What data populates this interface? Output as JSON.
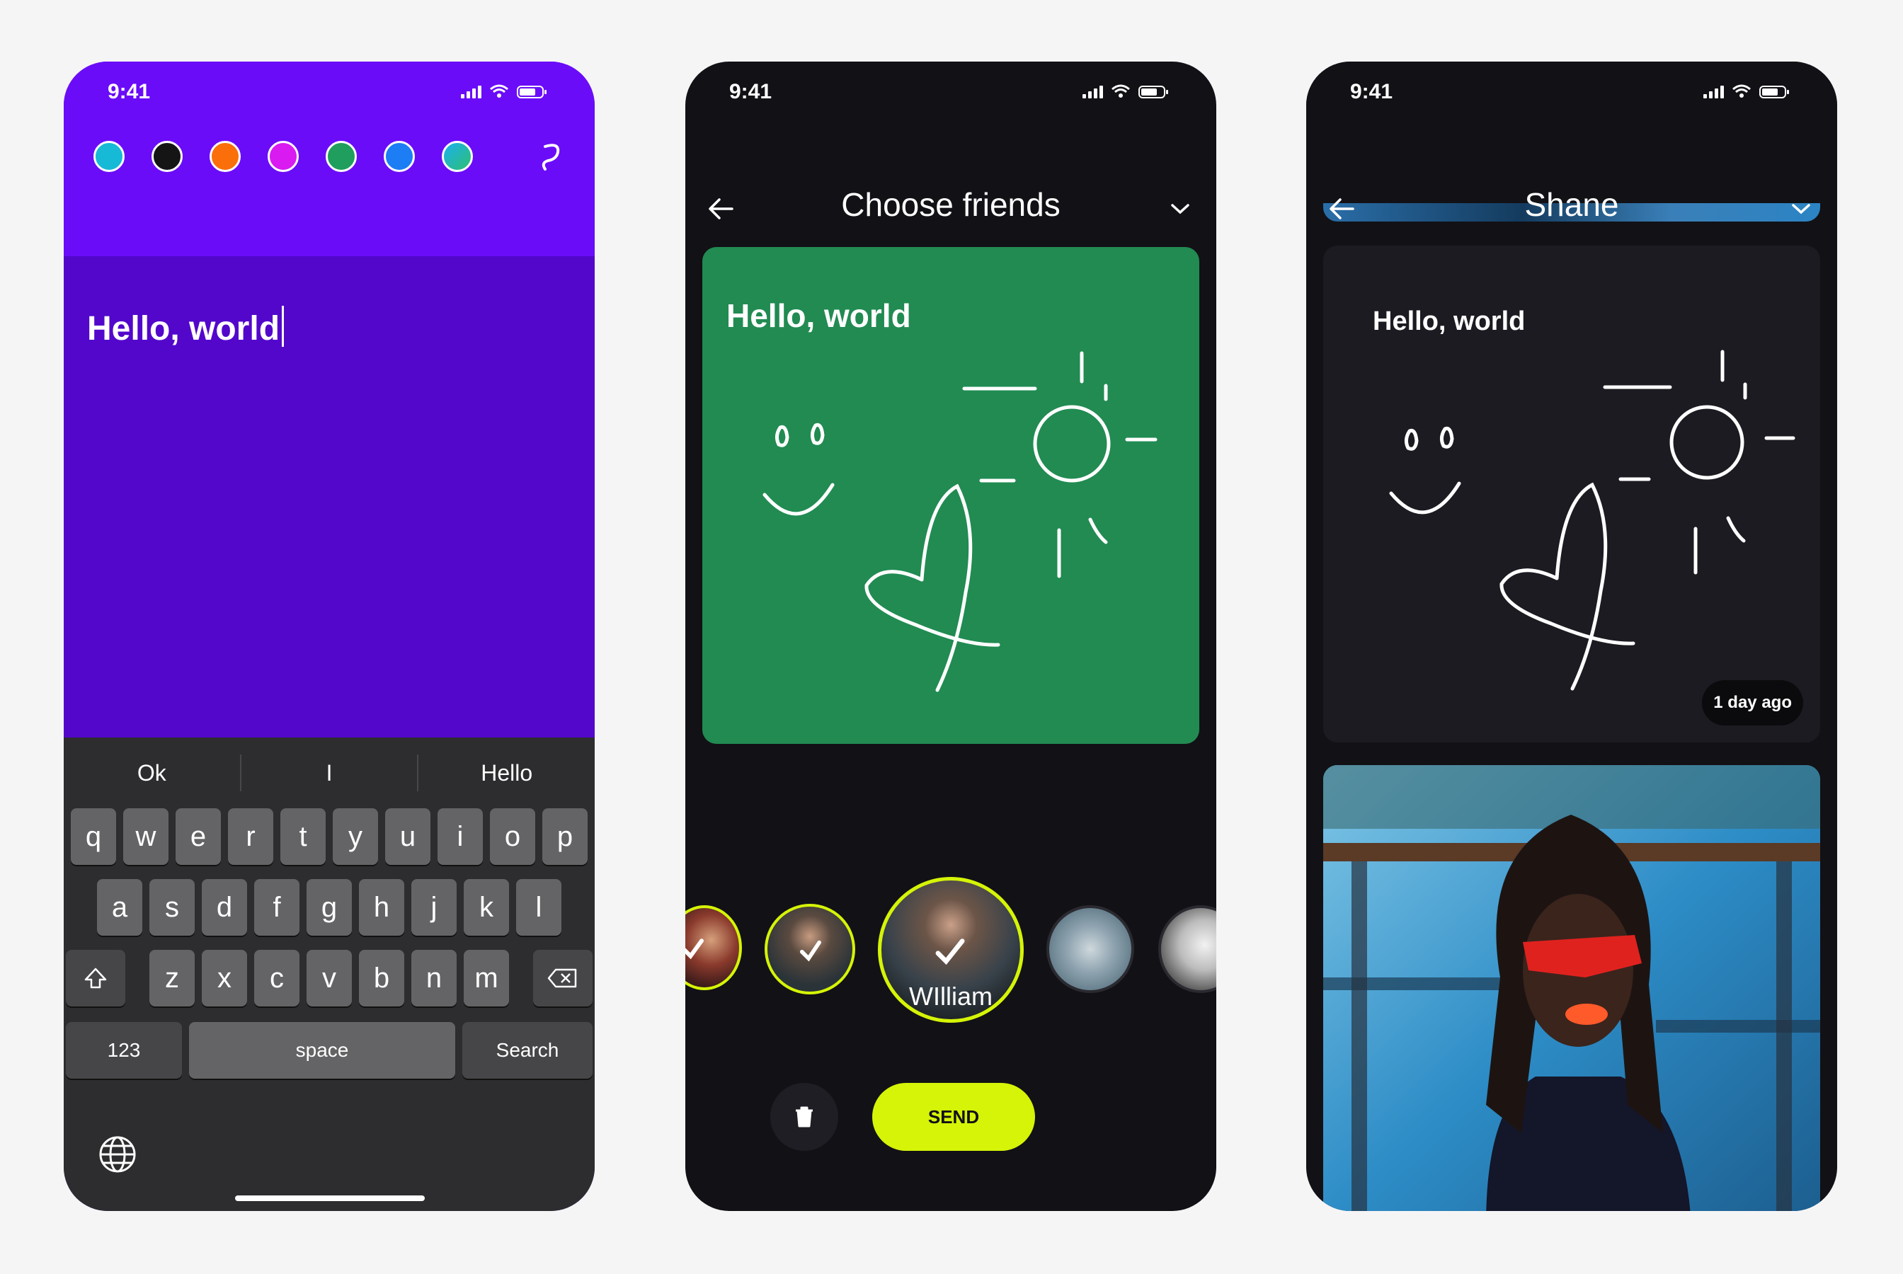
{
  "colors": {
    "canvas": "#f5f5f6",
    "phone1_top": "#6b0cf8",
    "phone1_bg": "#5307cb",
    "dark_bg": "#121116",
    "card_green": "#218b52",
    "send_accent": "#d5f407",
    "selected_ring": "#d5f407"
  },
  "phone1": {
    "status_time": "9:41",
    "swatches": [
      "#16b9d6",
      "#151515",
      "#fa6f0a",
      "#d91af0",
      "#1f9e5d",
      "#1c7df5",
      "gradient-teal-green"
    ],
    "redo_icon": "redo-icon",
    "note_text": "Hello, world",
    "suggestions": [
      "Ok",
      "I",
      "Hello"
    ],
    "keys": {
      "row1": [
        "q",
        "w",
        "e",
        "r",
        "t",
        "y",
        "u",
        "i",
        "o",
        "p"
      ],
      "row2": [
        "a",
        "s",
        "d",
        "f",
        "g",
        "h",
        "j",
        "k",
        "l"
      ],
      "row3": [
        "z",
        "x",
        "c",
        "v",
        "b",
        "n",
        "m"
      ],
      "numbers_label": "123",
      "space_label": "space",
      "search_label": "Search"
    }
  },
  "phone2": {
    "status_time": "9:41",
    "title": "Choose friends",
    "card_text": "Hello, world",
    "selected_friend": "WIlliam",
    "send_label": "SEND"
  },
  "phone3": {
    "status_time": "9:41",
    "title": "Shane",
    "card_text": "Hello, world",
    "time_badge": "1 day ago"
  }
}
